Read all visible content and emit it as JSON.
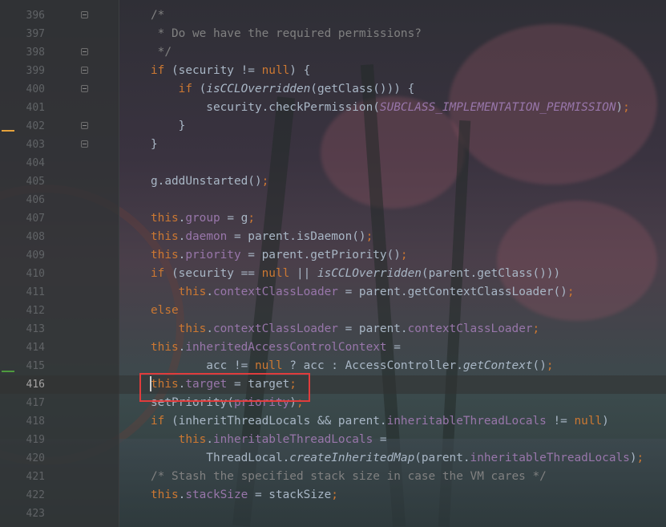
{
  "colors": {
    "editor_bg": "#2b2b2b",
    "keyword": "#cc7832",
    "field": "#9876aa",
    "comment": "#808080",
    "plain": "#a9b7c6",
    "line_number": "#606366",
    "highlight_box": "#e03c3c",
    "gutter_marker_warning": "#e6a23c",
    "gutter_marker_change": "#4e9a3e"
  },
  "editor": {
    "current_line": "416",
    "lines": [
      {
        "number": "396",
        "fold": true,
        "tokens": [
          {
            "t": "/*",
            "c": "cmt"
          }
        ]
      },
      {
        "number": "397",
        "fold": false,
        "tokens": [
          {
            "t": " * Do we have the required permissions?",
            "c": "cmt"
          }
        ]
      },
      {
        "number": "398",
        "fold": true,
        "tokens": [
          {
            "t": " */",
            "c": "cmt"
          }
        ]
      },
      {
        "number": "399",
        "fold": true,
        "tokens": [
          {
            "t": "if",
            "c": "kw"
          },
          {
            "t": " (security != ",
            "c": ""
          },
          {
            "t": "null",
            "c": "kw"
          },
          {
            "t": ") {",
            "c": ""
          }
        ]
      },
      {
        "number": "400",
        "fold": true,
        "tokens": [
          {
            "t": "    ",
            "c": ""
          },
          {
            "t": "if",
            "c": "kw"
          },
          {
            "t": " (",
            "c": ""
          },
          {
            "t": "isCCLOverridden",
            "c": "ital"
          },
          {
            "t": "(getClass())) {",
            "c": ""
          }
        ]
      },
      {
        "number": "401",
        "fold": false,
        "tokens": [
          {
            "t": "        security.checkPermission(",
            "c": ""
          },
          {
            "t": "SUBCLASS_IMPLEMENTATION_PERMISSION",
            "c": "cst"
          },
          {
            "t": ")",
            "c": ""
          },
          {
            "t": ";",
            "c": "kw"
          }
        ]
      },
      {
        "number": "402",
        "fold": true,
        "tokens": [
          {
            "t": "    }",
            "c": ""
          }
        ]
      },
      {
        "number": "403",
        "fold": true,
        "tokens": [
          {
            "t": "}",
            "c": ""
          }
        ]
      },
      {
        "number": "404",
        "fold": false,
        "tokens": []
      },
      {
        "number": "405",
        "fold": false,
        "tokens": [
          {
            "t": "g.addUnstarted()",
            "c": ""
          },
          {
            "t": ";",
            "c": "kw"
          }
        ]
      },
      {
        "number": "406",
        "fold": false,
        "tokens": []
      },
      {
        "number": "407",
        "fold": false,
        "tokens": [
          {
            "t": "this",
            "c": "kw"
          },
          {
            "t": ".",
            "c": ""
          },
          {
            "t": "group",
            "c": "fld"
          },
          {
            "t": " = g",
            "c": ""
          },
          {
            "t": ";",
            "c": "kw"
          }
        ]
      },
      {
        "number": "408",
        "fold": false,
        "tokens": [
          {
            "t": "this",
            "c": "kw"
          },
          {
            "t": ".",
            "c": ""
          },
          {
            "t": "daemon",
            "c": "fld"
          },
          {
            "t": " = parent.isDaemon()",
            "c": ""
          },
          {
            "t": ";",
            "c": "kw"
          }
        ]
      },
      {
        "number": "409",
        "fold": false,
        "tokens": [
          {
            "t": "this",
            "c": "kw"
          },
          {
            "t": ".",
            "c": ""
          },
          {
            "t": "priority",
            "c": "fld"
          },
          {
            "t": " = parent.getPriority()",
            "c": ""
          },
          {
            "t": ";",
            "c": "kw"
          }
        ]
      },
      {
        "number": "410",
        "fold": false,
        "tokens": [
          {
            "t": "if",
            "c": "kw"
          },
          {
            "t": " (security == ",
            "c": ""
          },
          {
            "t": "null",
            "c": "kw"
          },
          {
            "t": " || ",
            "c": ""
          },
          {
            "t": "isCCLOverridden",
            "c": "ital"
          },
          {
            "t": "(parent.getClass()))",
            "c": ""
          }
        ]
      },
      {
        "number": "411",
        "fold": false,
        "tokens": [
          {
            "t": "    ",
            "c": ""
          },
          {
            "t": "this",
            "c": "kw"
          },
          {
            "t": ".",
            "c": ""
          },
          {
            "t": "contextClassLoader",
            "c": "fld"
          },
          {
            "t": " = parent.getContextClassLoader()",
            "c": ""
          },
          {
            "t": ";",
            "c": "kw"
          }
        ]
      },
      {
        "number": "412",
        "fold": false,
        "tokens": [
          {
            "t": "else",
            "c": "kw"
          }
        ]
      },
      {
        "number": "413",
        "fold": false,
        "tokens": [
          {
            "t": "    ",
            "c": ""
          },
          {
            "t": "this",
            "c": "kw"
          },
          {
            "t": ".",
            "c": ""
          },
          {
            "t": "contextClassLoader",
            "c": "fld"
          },
          {
            "t": " = parent.",
            "c": ""
          },
          {
            "t": "contextClassLoader",
            "c": "fld"
          },
          {
            "t": ";",
            "c": "kw"
          }
        ]
      },
      {
        "number": "414",
        "fold": false,
        "tokens": [
          {
            "t": "this",
            "c": "kw"
          },
          {
            "t": ".",
            "c": ""
          },
          {
            "t": "inheritedAccessControlContext",
            "c": "fld"
          },
          {
            "t": " =",
            "c": ""
          }
        ]
      },
      {
        "number": "415",
        "fold": false,
        "tokens": [
          {
            "t": "        acc != ",
            "c": ""
          },
          {
            "t": "null",
            "c": "kw"
          },
          {
            "t": " ? acc : AccessController.",
            "c": ""
          },
          {
            "t": "getContext",
            "c": "ital"
          },
          {
            "t": "()",
            "c": ""
          },
          {
            "t": ";",
            "c": "kw"
          }
        ]
      },
      {
        "number": "416",
        "fold": false,
        "tokens": [
          {
            "t": "this",
            "c": "kw"
          },
          {
            "t": ".",
            "c": ""
          },
          {
            "t": "target",
            "c": "fld"
          },
          {
            "t": " = target",
            "c": ""
          },
          {
            "t": ";",
            "c": "kw"
          }
        ]
      },
      {
        "number": "417",
        "fold": false,
        "tokens": [
          {
            "t": "setPriority(",
            "c": ""
          },
          {
            "t": "priority",
            "c": "fld"
          },
          {
            "t": ")",
            "c": ""
          },
          {
            "t": ";",
            "c": "kw"
          }
        ]
      },
      {
        "number": "418",
        "fold": false,
        "tokens": [
          {
            "t": "if",
            "c": "kw"
          },
          {
            "t": " (inheritThreadLocals && parent.",
            "c": ""
          },
          {
            "t": "inheritableThreadLocals",
            "c": "fld"
          },
          {
            "t": " != ",
            "c": ""
          },
          {
            "t": "null",
            "c": "kw"
          },
          {
            "t": ")",
            "c": ""
          }
        ]
      },
      {
        "number": "419",
        "fold": false,
        "tokens": [
          {
            "t": "    ",
            "c": ""
          },
          {
            "t": "this",
            "c": "kw"
          },
          {
            "t": ".",
            "c": ""
          },
          {
            "t": "inheritableThreadLocals",
            "c": "fld"
          },
          {
            "t": " =",
            "c": ""
          }
        ]
      },
      {
        "number": "420",
        "fold": false,
        "tokens": [
          {
            "t": "        ThreadLocal.",
            "c": ""
          },
          {
            "t": "createInheritedMap",
            "c": "ital"
          },
          {
            "t": "(parent.",
            "c": ""
          },
          {
            "t": "inheritableThreadLocals",
            "c": "fld"
          },
          {
            "t": ")",
            "c": ""
          },
          {
            "t": ";",
            "c": "kw"
          }
        ]
      },
      {
        "number": "421",
        "fold": false,
        "tokens": [
          {
            "t": "/* Stash the specified stack size in case the VM cares */",
            "c": "cmt"
          }
        ]
      },
      {
        "number": "422",
        "fold": false,
        "tokens": [
          {
            "t": "this",
            "c": "kw"
          },
          {
            "t": ".",
            "c": ""
          },
          {
            "t": "stackSize",
            "c": "fld"
          },
          {
            "t": " = stackSize",
            "c": ""
          },
          {
            "t": ";",
            "c": "kw"
          }
        ]
      },
      {
        "number": "423",
        "fold": false,
        "tokens": []
      }
    ]
  }
}
